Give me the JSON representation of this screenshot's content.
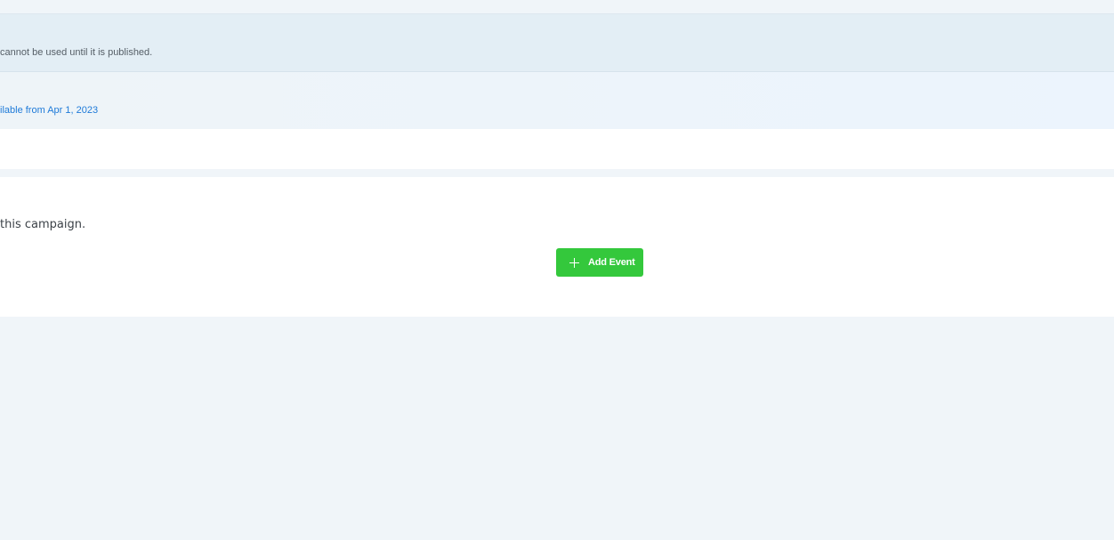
{
  "notice": {
    "text": "cannot be used until it is published."
  },
  "availability": {
    "text": "ilable from Apr 1, 2023"
  },
  "events": {
    "empty_text": "this campaign.",
    "add_button_label": "Add Event",
    "add_button_icon": "plus-icon"
  },
  "colors": {
    "button_green": "#34c83c",
    "link_blue": "#1e7ad8",
    "background": "#f0f5f9"
  }
}
